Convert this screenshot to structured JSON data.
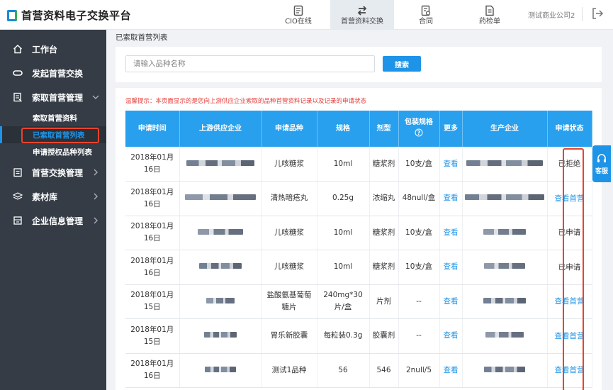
{
  "app": {
    "title": "首营资料电子交换平台"
  },
  "nav": [
    {
      "label": "CIO在线",
      "icon": "cio-icon",
      "active": false
    },
    {
      "label": "首营资料交换",
      "icon": "exchange-icon",
      "active": true
    },
    {
      "label": "合同",
      "icon": "contract-icon",
      "active": false
    },
    {
      "label": "药检单",
      "icon": "report-icon",
      "active": false
    }
  ],
  "user": {
    "company": "测试商业公司2"
  },
  "sidebar": {
    "items": [
      {
        "label": "工作台",
        "icon": "home-icon"
      },
      {
        "label": "发起首营交换",
        "icon": "link-icon"
      },
      {
        "label": "索取首营管理",
        "icon": "request-icon",
        "expanded": true
      },
      {
        "label": "首营交换管理",
        "icon": "folder-icon"
      },
      {
        "label": "素材库",
        "icon": "layers-icon"
      },
      {
        "label": "企业信息管理",
        "icon": "building-icon"
      }
    ],
    "sub_items": [
      {
        "label": "索取首营资料",
        "active": false
      },
      {
        "label": "已索取首营列表",
        "active": true
      },
      {
        "label": "申请授权品种列表",
        "active": false
      }
    ]
  },
  "breadcrumb": "已索取首营列表",
  "search": {
    "placeholder": "请输入品种名称",
    "button": "搜索"
  },
  "tip": "温馨提示：本页面显示的是您向上游供应企业索取的品种首营资料记录以及记录的申请状态",
  "table": {
    "headers": [
      "申请时间",
      "上游供应企业",
      "申请品种",
      "规格",
      "剂型",
      "包装规格",
      "更多",
      "生产企业",
      "申请状态"
    ],
    "rows": [
      {
        "date": "2018年01月16日",
        "product": "儿咳糖浆",
        "spec": "10ml",
        "form": "糖浆剂",
        "pack": "10支/盒",
        "more": "查看",
        "status": "已拒绝",
        "status_link": false
      },
      {
        "date": "2018年01月16日",
        "product": "清热暗疮丸",
        "spec": "0.25g",
        "form": "浓缩丸",
        "pack": "48null/盒",
        "more": "查看",
        "status": "查看首营",
        "status_link": true
      },
      {
        "date": "2018年01月16日",
        "product": "儿咳糖浆",
        "spec": "10ml",
        "form": "糖浆剂",
        "pack": "10支/盒",
        "more": "查看",
        "status": "已申请",
        "status_link": false
      },
      {
        "date": "2018年01月16日",
        "product": "儿咳糖浆",
        "spec": "10ml",
        "form": "糖浆剂",
        "pack": "10支/盒",
        "more": "查看",
        "status": "已申请",
        "status_link": false
      },
      {
        "date": "2018年01月15日",
        "product": "盐酸氨基葡萄糖片",
        "spec": "240mg*30片/盒",
        "form": "片剂",
        "pack": "--",
        "more": "查看",
        "status": "查看首营",
        "status_link": true
      },
      {
        "date": "2018年01月15日",
        "product": "胃乐新胶囊",
        "spec": "每粒装0.3g",
        "form": "胶囊剂",
        "pack": "--",
        "more": "查看",
        "status": "查看首营",
        "status_link": true
      },
      {
        "date": "2018年01月16日",
        "product": "测试1品种",
        "spec": "56",
        "form": "546",
        "pack": "2null/5",
        "more": "查看",
        "status": "查看首营",
        "status_link": true
      }
    ]
  },
  "float_service": {
    "label": "客服"
  },
  "colors": {
    "accent": "#1e94e8",
    "sidebar": "#353c46",
    "header_bg": "#28a0ee",
    "highlight": "#e8432d",
    "tip": "#e53935"
  }
}
